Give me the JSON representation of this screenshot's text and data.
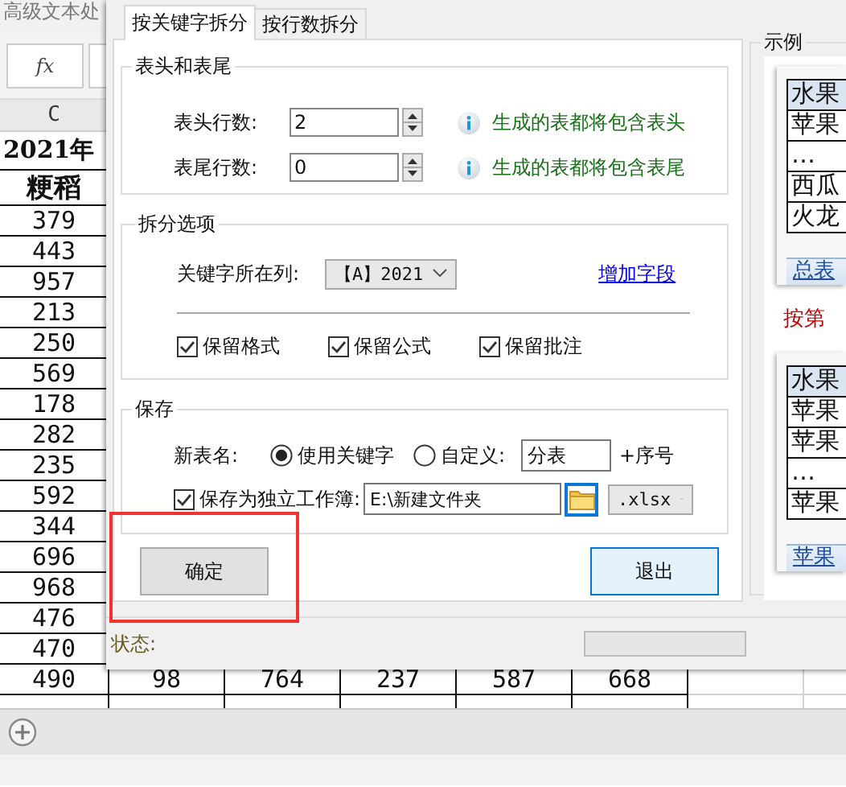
{
  "sheet": {
    "title": "高级文本处",
    "formula_label": "fx",
    "column_header": "C",
    "title_cell": "2021年",
    "header_cell": "粳稻",
    "column_values": [
      "379",
      "443",
      "957",
      "213",
      "250",
      "569",
      "178",
      "282",
      "235",
      "592",
      "344",
      "696",
      "968",
      "476",
      "470"
    ],
    "full_row": [
      "490",
      "98",
      "764",
      "237",
      "587",
      "668"
    ]
  },
  "dialog": {
    "tabs": [
      {
        "label": "按关键字拆分",
        "selected": true
      },
      {
        "label": "按行数拆分",
        "selected": false
      }
    ],
    "header_footer": {
      "title": "表头和表尾",
      "rows": [
        {
          "label": "表头行数:",
          "value": "2",
          "hint": "生成的表都将包含表头"
        },
        {
          "label": "表尾行数:",
          "value": "0",
          "hint": "生成的表都将包含表尾"
        }
      ]
    },
    "split_options": {
      "title": "拆分选项",
      "key_column_label": "关键字所在列:",
      "key_column_value": "【A】2021",
      "add_field_link": "增加字段",
      "checkboxes": [
        {
          "label": "保留格式",
          "checked": true
        },
        {
          "label": "保留公式",
          "checked": true
        },
        {
          "label": "保留批注",
          "checked": true
        }
      ]
    },
    "save": {
      "title": "保存",
      "name_label": "新表名:",
      "name_options": [
        {
          "label": "使用关键字",
          "selected": true
        },
        {
          "label": "自定义:",
          "selected": false
        }
      ],
      "custom_name": "分表",
      "suffix": "+序号",
      "separate_workbook": {
        "label": "保存为独立工作簿:",
        "checked": true
      },
      "folder": "E:\\新建文件夹",
      "extension": ".xlsx"
    },
    "buttons": [
      {
        "label": "确定",
        "kind": "default"
      },
      {
        "label": "退出",
        "kind": "focused"
      }
    ],
    "example": {
      "title": "示例",
      "caption": "按第",
      "previews": [
        {
          "cells": [
            "水果",
            "苹果",
            "…",
            "西瓜",
            "火龙"
          ],
          "sheet_tab": "总表"
        },
        {
          "cells": [
            "水果",
            "苹果",
            "苹果",
            "…",
            "苹果"
          ],
          "sheet_tab": "苹果"
        }
      ]
    },
    "status": {
      "label": "状态:"
    }
  }
}
